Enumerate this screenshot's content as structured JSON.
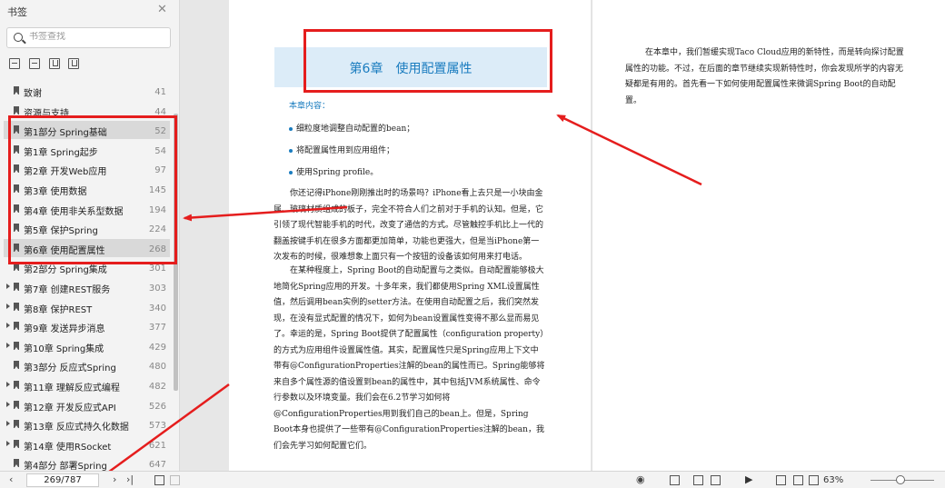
{
  "sidebar": {
    "title": "书签",
    "search_placeholder": "书签查找",
    "toc": [
      {
        "label": "致谢",
        "page": "41",
        "caret": false,
        "selected": false
      },
      {
        "label": "资源与支持",
        "page": "44",
        "caret": false,
        "selected": false
      },
      {
        "label": "第1部分 Spring基础",
        "page": "52",
        "caret": false,
        "selected": true
      },
      {
        "label": "第1章 Spring起步",
        "page": "54",
        "caret": false,
        "selected": false
      },
      {
        "label": "第2章 开发Web应用",
        "page": "97",
        "caret": false,
        "selected": false
      },
      {
        "label": "第3章 使用数据",
        "page": "145",
        "caret": false,
        "selected": false
      },
      {
        "label": "第4章 使用非关系型数据",
        "page": "194",
        "caret": false,
        "selected": false
      },
      {
        "label": "第5章 保护Spring",
        "page": "224",
        "caret": false,
        "selected": false
      },
      {
        "label": "第6章 使用配置属性",
        "page": "268",
        "caret": false,
        "selected": true
      },
      {
        "label": "第2部分 Spring集成",
        "page": "301",
        "caret": false,
        "selected": false
      },
      {
        "label": "第7章 创建REST服务",
        "page": "303",
        "caret": true,
        "selected": false
      },
      {
        "label": "第8章 保护REST",
        "page": "340",
        "caret": true,
        "selected": false
      },
      {
        "label": "第9章 发送异步消息",
        "page": "377",
        "caret": true,
        "selected": false
      },
      {
        "label": "第10章 Spring集成",
        "page": "429",
        "caret": true,
        "selected": false
      },
      {
        "label": "第3部分 反应式Spring",
        "page": "480",
        "caret": false,
        "selected": false
      },
      {
        "label": "第11章 理解反应式编程",
        "page": "482",
        "caret": true,
        "selected": false
      },
      {
        "label": "第12章 开发反应式API",
        "page": "526",
        "caret": true,
        "selected": false
      },
      {
        "label": "第13章 反应式持久化数据",
        "page": "573",
        "caret": true,
        "selected": false
      },
      {
        "label": "第14章 使用RSocket",
        "page": "621",
        "caret": true,
        "selected": false
      },
      {
        "label": "第4部分 部署Spring",
        "page": "647",
        "caret": false,
        "selected": false
      }
    ]
  },
  "page": {
    "chapter_title": "第6章　使用配置属性",
    "content_title": "本章内容：",
    "bullets": [
      "细粒度地调整自动配置的bean；",
      "将配置属性用到应用组件；",
      "使用Spring profile。"
    ],
    "paragraphs": [
      "你还记得iPhone刚刚推出时的场景吗？iPhone看上去只是一小块由金属、玻璃材质组成的板子，完全不符合人们之前对于手机的认知。但是，它引领了现代智能手机的时代，改变了通信的方式。尽管触控手机比上一代的翻盖按键手机在很多方面都更加简单，功能也更强大，但是当iPhone第一次发布的时候，很难想象上面只有一个按钮的设备该如何用来打电话。",
      "在某种程度上，Spring Boot的自动配置与之类似。自动配置能够极大地简化Spring应用的开发。十多年来，我们都使用Spring XML设置属性值，然后调用bean实例的setter方法。在使用自动配置之后，我们突然发现，在没有显式配置的情况下，如何为bean设置属性变得不那么显而易见了。",
      "幸运的是，Spring Boot提供了配置属性（configuration property）的方式为应用组件设置属性值。其实，配置属性只是Spring应用上下文中带有@ConfigurationProperties注解的bean的属性而已。Spring能够将来自多个属性源的值设置到bean的属性中，其中包括JVM系统属性、命令行参数以及环境变量。我们会在6.2节学习如何将@ConfigurationProperties用到我们自己的bean上。但是，Spring Boot本身也提供了一些带有@ConfigurationProperties注解的bean，我们会先学习如何配置它们。"
    ],
    "right_paragraph": "在本章中，我们暂缓实现Taco Cloud应用的新特性，而是转向探讨配置属性的功能。不过，在后面的章节继续实现新特性时，你会发现所学的内容无疑都是有用的。首先看一下如何使用配置属性来微调Spring Boot的自动配置。"
  },
  "statusbar": {
    "page_indicator": "269/787",
    "zoom": "63%"
  },
  "icons": [
    "close-icon",
    "search-icon",
    "expand-all-icon",
    "collapse-all-icon",
    "add-bookmark-icon",
    "bookmark-icon",
    "prev-page-icon",
    "next-page-icon",
    "last-page-icon",
    "single-page-icon",
    "two-page-icon",
    "play-icon",
    "fit-width-icon",
    "fit-page-icon",
    "eye-icon"
  ],
  "colors": {
    "annotation_red": "#e51d1d",
    "heading_blue": "#1a7cbf",
    "chapter_band": "#dcecf8"
  }
}
